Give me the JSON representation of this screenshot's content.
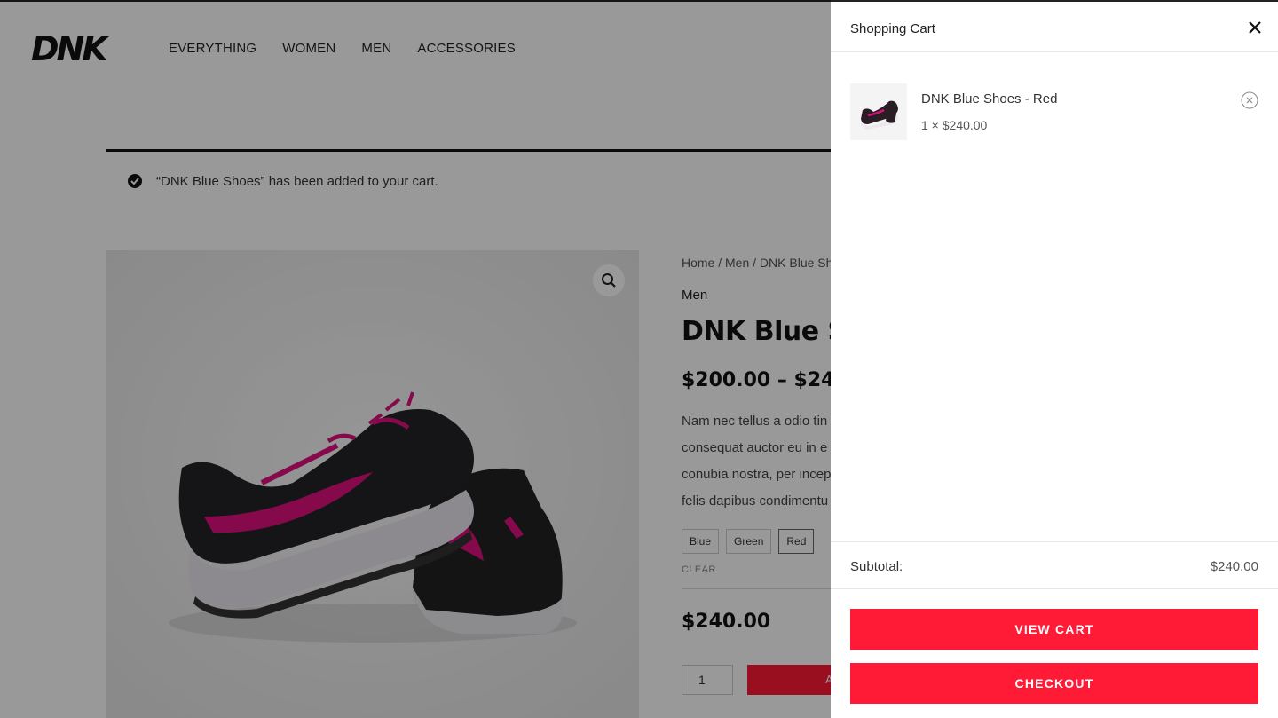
{
  "brand": {
    "logo_text": "DNK"
  },
  "nav": {
    "items": [
      "EVERYTHING",
      "WOMEN",
      "MEN",
      "ACCESSORIES"
    ]
  },
  "notice": {
    "message": "“DNK Blue Shoes” has been added to your cart."
  },
  "product": {
    "breadcrumb": "Home / Men / DNK Blue Sh",
    "category": "Men",
    "title": "DNK Blue Sh",
    "price_range": "$200.00 – $240",
    "description_lines": [
      "Nam nec tellus a odio tin",
      "consequat auctor eu in e",
      "conubia nostra, per incep",
      "felis dapibus condimentu"
    ],
    "variations": [
      "Blue",
      "Green",
      "Red"
    ],
    "selected_variation": "Red",
    "clear_label": "CLEAR",
    "variation_price": "$240.00",
    "quantity": "1",
    "add_button_label": "A"
  },
  "cart": {
    "title": "Shopping Cart",
    "items": [
      {
        "name": "DNK Blue Shoes - Red",
        "qty_price": "1 × $240.00"
      }
    ],
    "subtotal_label": "Subtotal:",
    "subtotal_value": "$240.00",
    "view_cart_label": "VIEW CART",
    "checkout_label": "CHECKOUT"
  },
  "colors": {
    "accent": "#ff1a36",
    "text_dark": "#111111"
  },
  "icons": {
    "close": "close-icon",
    "remove": "remove-circle-icon",
    "zoom": "magnifier-icon",
    "notice": "check-circle-icon"
  }
}
